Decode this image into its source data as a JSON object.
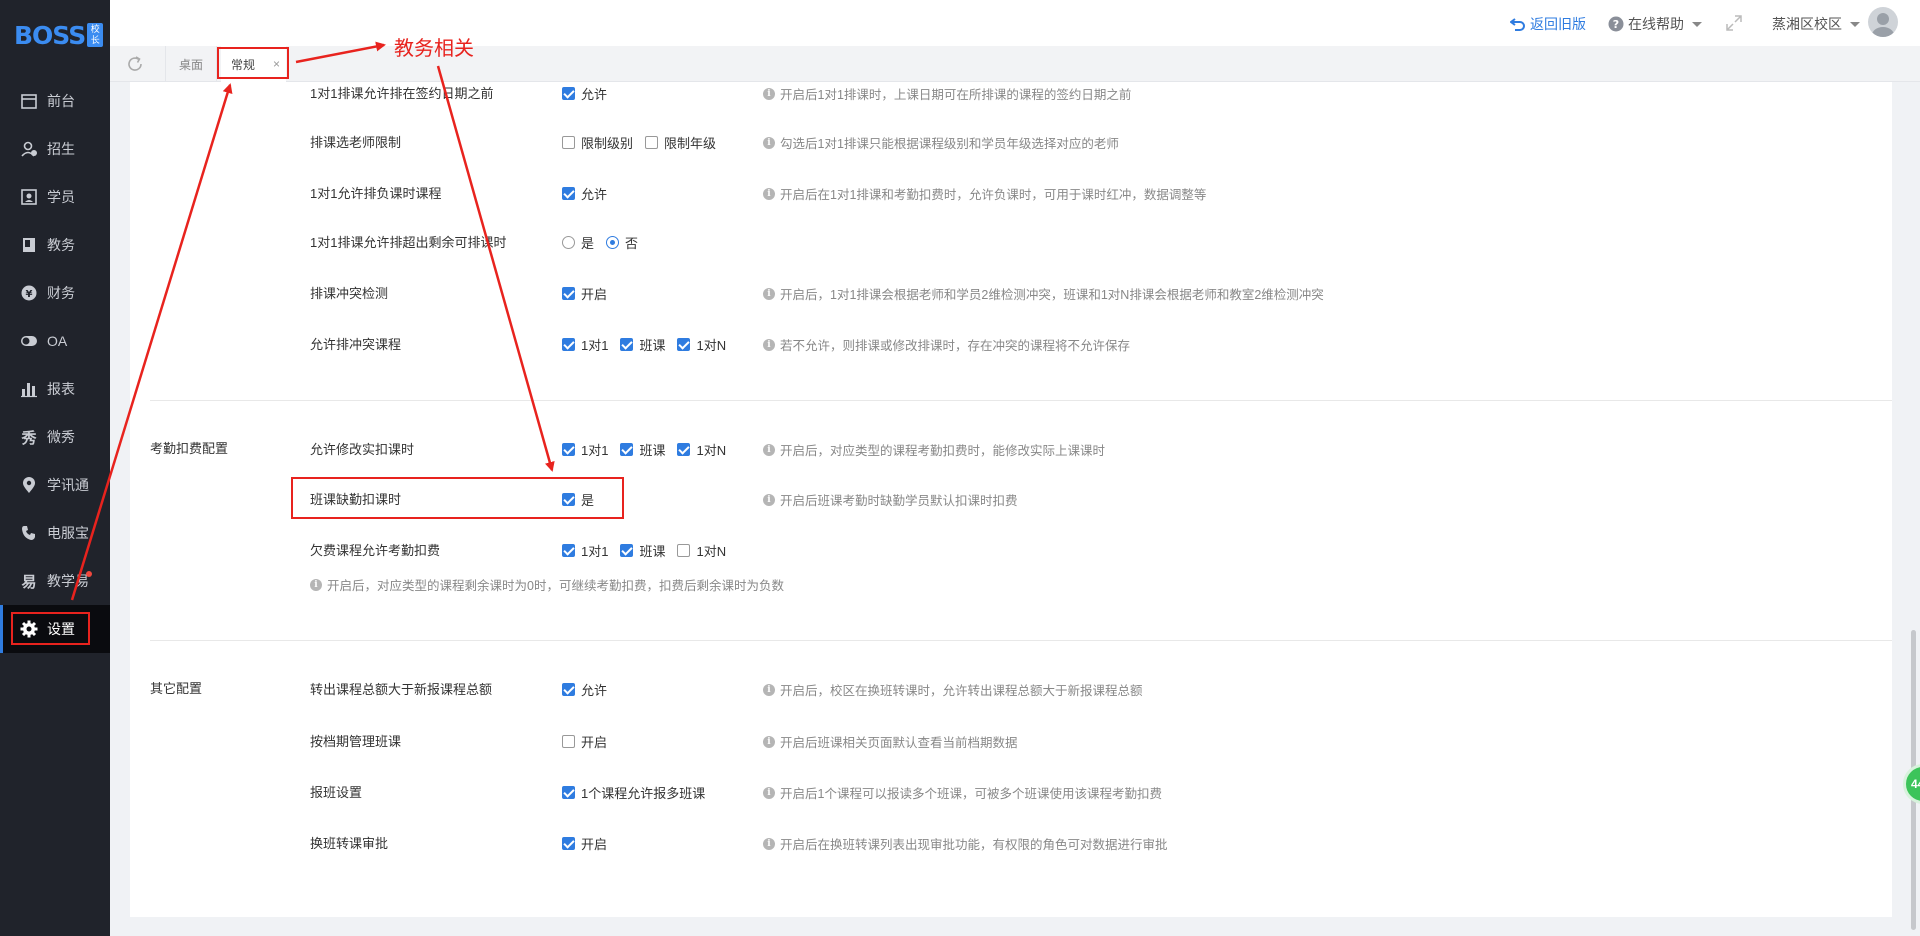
{
  "sidebar": {
    "logo": "BOSS",
    "logo_mark": "校长",
    "items": [
      {
        "label": "前台",
        "icon": "calendar-icon"
      },
      {
        "label": "招生",
        "icon": "user-add-icon"
      },
      {
        "label": "学员",
        "icon": "id-card-icon"
      },
      {
        "label": "教务",
        "icon": "book-icon"
      },
      {
        "label": "财务",
        "icon": "yen-icon"
      },
      {
        "label": "OA",
        "icon": "toggle-icon"
      },
      {
        "label": "报表",
        "icon": "bar-chart-icon"
      },
      {
        "label": "微秀",
        "icon": "show-icon"
      },
      {
        "label": "学讯通",
        "icon": "location-icon"
      },
      {
        "label": "电服宝",
        "icon": "phone-icon"
      },
      {
        "label": "教学易",
        "icon": "teach-icon"
      },
      {
        "label": "设置",
        "icon": "gear-icon"
      }
    ]
  },
  "header": {
    "back_old": "返回旧版",
    "help": "在线帮助",
    "campus": "蒸湘区校区"
  },
  "tabs": [
    {
      "label": "桌面"
    },
    {
      "label": "常规",
      "close": "×"
    }
  ],
  "sections": {
    "sched_rows": [
      {
        "label": "1对1排课允许排在签约日期之前",
        "options": [
          {
            "type": "checkbox",
            "text": "允许",
            "checked": true
          }
        ],
        "hint": "开启后1对1排课时，上课日期可在所排课的课程的签约日期之前"
      },
      {
        "label": "排课选老师限制",
        "options": [
          {
            "type": "checkbox",
            "text": "限制级别",
            "checked": false
          },
          {
            "type": "checkbox",
            "text": "限制年级",
            "checked": false
          }
        ],
        "hint": "勾选后1对1排课只能根据课程级别和学员年级选择对应的老师"
      },
      {
        "label": "1对1允许排负课时课程",
        "options": [
          {
            "type": "checkbox",
            "text": "允许",
            "checked": true
          }
        ],
        "hint": "开启后在1对1排课和考勤扣费时，允许负课时，可用于课时红冲，数据调整等"
      },
      {
        "label": "1对1排课允许排超出剩余可排课时",
        "options": [
          {
            "type": "radio",
            "text": "是",
            "checked": false
          },
          {
            "type": "radio",
            "text": "否",
            "checked": true
          }
        ],
        "hint": ""
      },
      {
        "label": "排课冲突检测",
        "options": [
          {
            "type": "checkbox",
            "text": "开启",
            "checked": true
          }
        ],
        "hint": "开启后，1对1排课会根据老师和学员2维检测冲突，班课和1对N排课会根据老师和教室2维检测冲突"
      },
      {
        "label": "允许排冲突课程",
        "options": [
          {
            "type": "checkbox",
            "text": "1对1",
            "checked": true
          },
          {
            "type": "checkbox",
            "text": "班课",
            "checked": true
          },
          {
            "type": "checkbox",
            "text": "1对N",
            "checked": true
          }
        ],
        "hint": "若不允许，则排课或修改排课时，存在冲突的课程将不允许保存"
      }
    ],
    "attendance": {
      "group_label": "考勤扣费配置",
      "rows": [
        {
          "label": "允许修改实扣课时",
          "options": [
            {
              "type": "checkbox",
              "text": "1对1",
              "checked": true
            },
            {
              "type": "checkbox",
              "text": "班课",
              "checked": true
            },
            {
              "type": "checkbox",
              "text": "1对N",
              "checked": true
            }
          ],
          "hint": "开启后，对应类型的课程考勤扣费时，能修改实际上课课时"
        },
        {
          "label": "班课缺勤扣课时",
          "options": [
            {
              "type": "checkbox",
              "text": "是",
              "checked": true
            }
          ],
          "hint": "开启后班课考勤时缺勤学员默认扣课时扣费"
        },
        {
          "label": "欠费课程允许考勤扣费",
          "options": [
            {
              "type": "checkbox",
              "text": "1对1",
              "checked": true
            },
            {
              "type": "checkbox",
              "text": "班课",
              "checked": true
            },
            {
              "type": "checkbox",
              "text": "1对N",
              "checked": false
            }
          ],
          "hint": ""
        }
      ],
      "footer_hint": "开启后，对应类型的课程剩余课时为0时，可继续考勤扣费，扣费后剩余课时为负数"
    },
    "other": {
      "group_label": "其它配置",
      "rows": [
        {
          "label": "转出课程总额大于新报课程总额",
          "options": [
            {
              "type": "checkbox",
              "text": "允许",
              "checked": true
            }
          ],
          "hint": "开启后，校区在换班转课时，允许转出课程总额大于新报课程总额"
        },
        {
          "label": "按档期管理班课",
          "options": [
            {
              "type": "checkbox",
              "text": "开启",
              "checked": false
            }
          ],
          "hint": "开启后班课相关页面默认查看当前档期数据"
        },
        {
          "label": "报班设置",
          "options": [
            {
              "type": "checkbox",
              "text": "1个课程允许报多班课",
              "checked": true
            }
          ],
          "hint": "开启后1个课程可以报读多个班课，可被多个班课使用该课程考勤扣费"
        },
        {
          "label": "换班转课审批",
          "options": [
            {
              "type": "checkbox",
              "text": "开启",
              "checked": true
            }
          ],
          "hint": "开启后在换班转课列表出现审批功能，有权限的角色可对数据进行审批"
        }
      ]
    }
  },
  "annotation": {
    "label": "教务相关",
    "color": "#e8231e"
  },
  "float_button": "44",
  "colors": {
    "sidebar_bg": "#20232b",
    "accent": "#2f7ce0",
    "annotation_red": "#e8231e"
  }
}
